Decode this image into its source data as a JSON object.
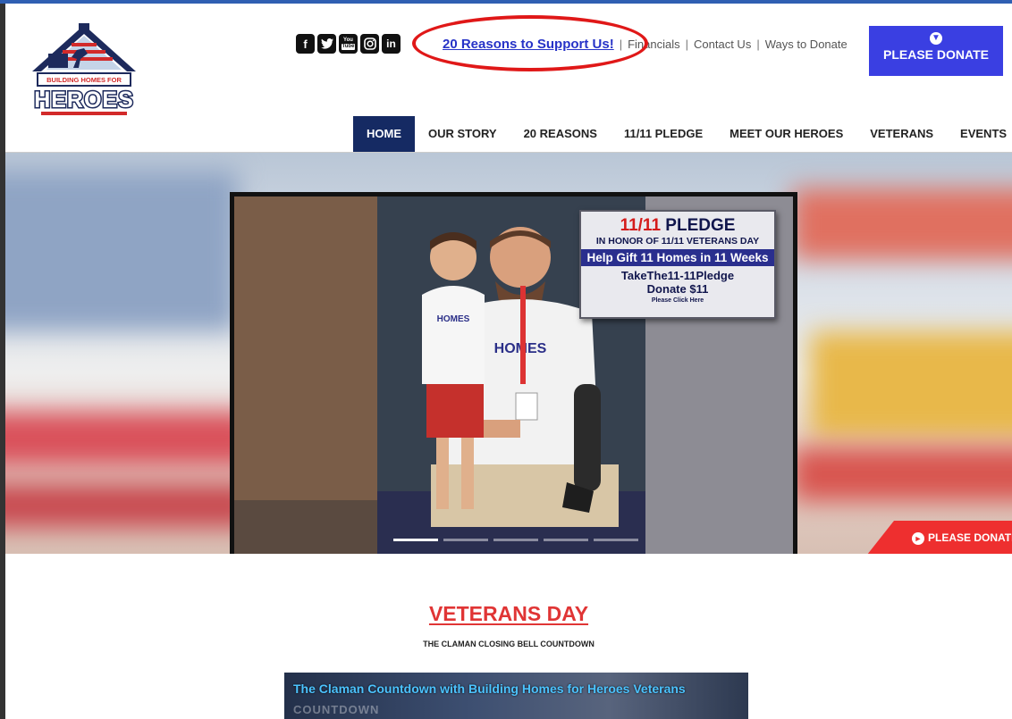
{
  "logo": {
    "line1": "BUILDING HOMES FOR",
    "line2": "HEROES"
  },
  "social": {
    "icons": [
      "facebook-icon",
      "twitter-icon",
      "youtube-icon",
      "instagram-icon",
      "linkedin-icon"
    ],
    "youtube_line1": "You",
    "youtube_line2": "Tube"
  },
  "toplinks": {
    "highlight": "20 Reasons to Support Us!",
    "links": [
      "Financials",
      "Contact Us",
      "Ways to Donate"
    ]
  },
  "donate_top": {
    "label": "PLEASE DONATE"
  },
  "nav": [
    "HOME",
    "OUR STORY",
    "20 REASONS",
    "11/11 PLEDGE",
    "MEET OUR HEROES",
    "VETERANS",
    "EVENTS"
  ],
  "hero": {
    "pledge_title_num": "11/11",
    "pledge_title_word": "PLEDGE",
    "pledge_line2": "IN HONOR OF 11/11 VETERANS DAY",
    "pledge_line3": "Help Gift 11 Homes in 11 Weeks",
    "pledge_line4": "TakeThe11-11Pledge",
    "pledge_line5": "Donate $11",
    "pledge_line6": "Please Click Here",
    "shirt_text": "BUILDING HOMES FOR HEROES",
    "donate_tab": "PLEASE DONATE",
    "slide_count": 5,
    "active_slide": 1
  },
  "section": {
    "title": "VETERANS DAY",
    "subtitle": "THE CLAMAN CLOSING BELL COUNTDOWN"
  },
  "video": {
    "title": "The Claman Countdown with Building Homes for Heroes Veterans",
    "bg_text": "COUNTDOWN"
  },
  "colors": {
    "accent_blue": "#3a3fe2",
    "nav_active": "#152a63",
    "red": "#e03535"
  }
}
